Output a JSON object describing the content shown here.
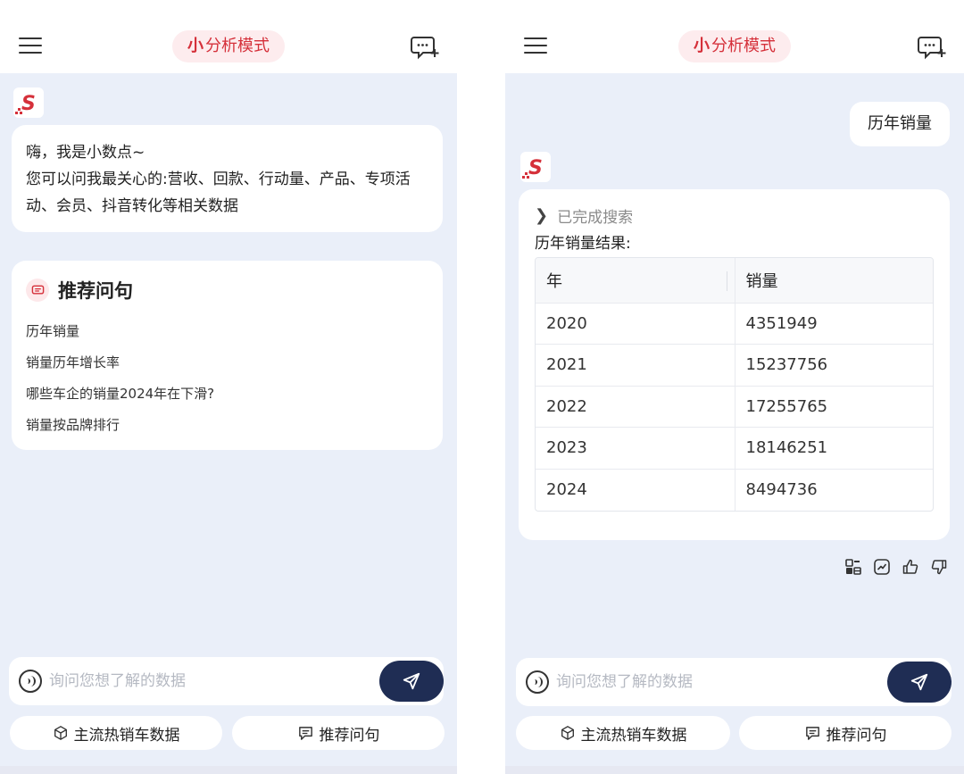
{
  "colors": {
    "accent_red": "#d5303a",
    "pill_bg": "#fdecee",
    "chat_bg": "#eaeff9",
    "send_button": "#1f2d54"
  },
  "left": {
    "header": {
      "mode_icon": "小",
      "mode_label": "分析模式"
    },
    "welcome": {
      "line1": "嗨，我是小数点~",
      "line2": "您可以问我最关心的:营收、回款、行动量、产品、专项活动、会员、抖音转化等相关数据"
    },
    "recommend": {
      "title": "推荐问句",
      "items": [
        {
          "label": "历年销量"
        },
        {
          "label": "销量历年增长率"
        },
        {
          "label": "哪些车企的销量2024年在下滑?"
        },
        {
          "label": "销量按品牌排行"
        }
      ]
    },
    "input": {
      "placeholder": "询问您想了解的数据"
    },
    "quick": {
      "hot_cars": "主流热销车数据",
      "recommend": "推荐问句"
    }
  },
  "right": {
    "header": {
      "mode_icon": "小",
      "mode_label": "分析模式"
    },
    "user_message": "历年销量",
    "answer": {
      "status": "已完成搜索",
      "result_label": "历年销量结果:",
      "table": {
        "headers": [
          "年",
          "销量"
        ],
        "rows": [
          [
            "2020",
            "4351949"
          ],
          [
            "2021",
            "15237756"
          ],
          [
            "2022",
            "17255765"
          ],
          [
            "2023",
            "18146251"
          ],
          [
            "2024",
            "8494736"
          ]
        ]
      }
    },
    "actions": [
      "table-view-icon",
      "chart-view-icon",
      "thumbs-up-icon",
      "thumbs-down-icon"
    ],
    "input": {
      "placeholder": "询问您想了解的数据"
    },
    "quick": {
      "hot_cars": "主流热销车数据",
      "recommend": "推荐问句"
    }
  }
}
